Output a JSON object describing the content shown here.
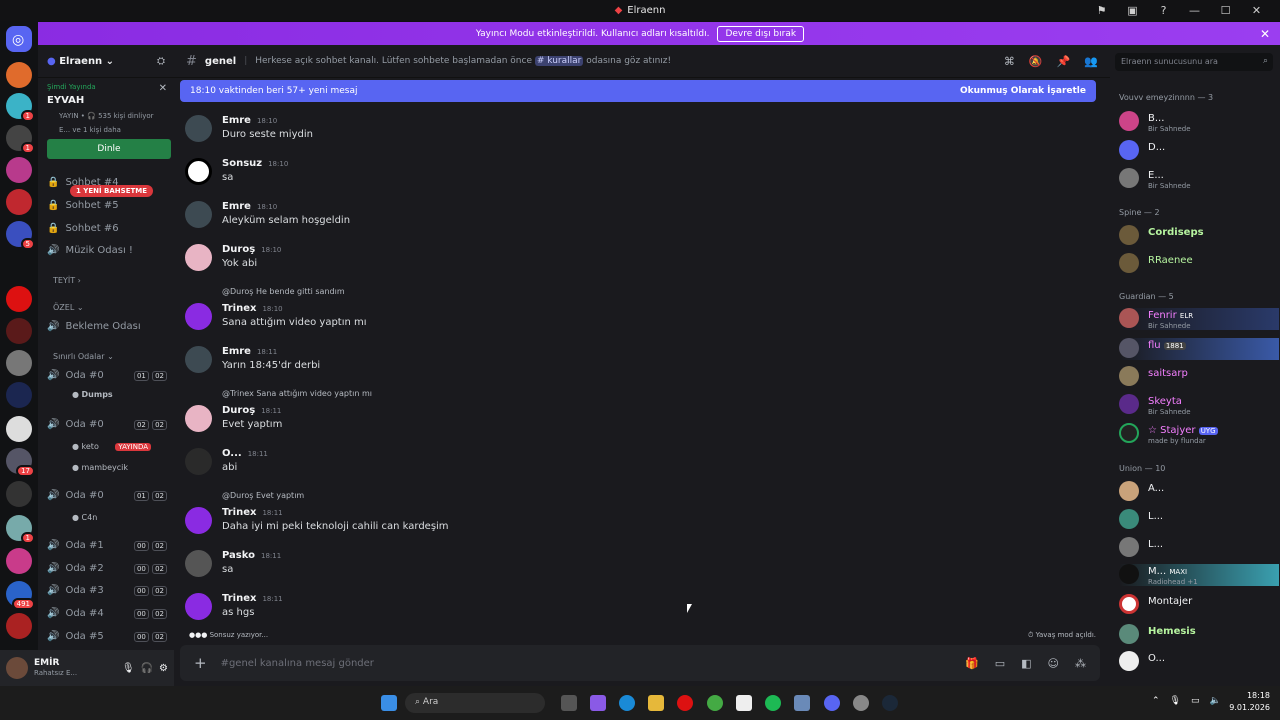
{
  "window": {
    "title": "Elraenn"
  },
  "banner": {
    "text": "Yayıncı Modu etkinleştirildi. Kullanıcı adları kısaltıldı.",
    "button": "Devre dışı bırak"
  },
  "server": {
    "name": "Elraenn"
  },
  "live_card": {
    "status": "Şimdi Yayında",
    "title": "EYVAH",
    "meta": "YAYIN • 🎧 535 kişi dinliyor",
    "listeners": "E... ve 1 kişi daha",
    "button": "Dinle"
  },
  "channels": {
    "mention_badge": "1 YENİ BAHSETME",
    "items": [
      "Sohbet #4",
      "Sohbet #5",
      "Sohbet #6",
      "Müzik Odası !"
    ],
    "cat_teyit": "TEYİT",
    "cat_ozel": "ÖZEL",
    "waiting": "Bekleme Odası",
    "cat_limited": "Sınırlı Odalar",
    "voice": [
      {
        "name": "Oda #0",
        "a": "01",
        "b": "02",
        "users": [
          {
            "name": "Dumps"
          }
        ]
      },
      {
        "name": "Oda #0",
        "a": "02",
        "b": "02",
        "users": [
          {
            "name": "keto",
            "live": "YAYINDA"
          },
          {
            "name": "mambeycik"
          }
        ]
      },
      {
        "name": "Oda #0",
        "a": "01",
        "b": "02",
        "users": [
          {
            "name": "C4n"
          }
        ]
      },
      {
        "name": "Oda #1",
        "a": "00",
        "b": "02"
      },
      {
        "name": "Oda #2",
        "a": "00",
        "b": "02"
      },
      {
        "name": "Oda #3",
        "a": "00",
        "b": "02"
      },
      {
        "name": "Oda #4",
        "a": "00",
        "b": "02"
      },
      {
        "name": "Oda #5",
        "a": "00",
        "b": "02"
      }
    ]
  },
  "user_panel": {
    "name": "EMİR",
    "status": "Rahatsız E..."
  },
  "channel_header": {
    "name": "genel",
    "topic_a": "Herkese açık sohbet kanalı. Lütfen sohbete başlamadan önce",
    "topic_link": "# kurallar",
    "topic_b": "odasına göz atınız!"
  },
  "new_bar": {
    "left": "18:10 vaktinden beri 57+ yeni mesaj",
    "right": "Okunmuş Olarak İşaretle"
  },
  "messages": [
    {
      "author": "Emre",
      "time": "18:10",
      "text": "Duro seste miydin"
    },
    {
      "author": "Sonsuz",
      "time": "18:10",
      "text": "sa"
    },
    {
      "author": "Emre",
      "time": "18:10",
      "text": "Aleyküm selam hoşgeldin"
    },
    {
      "author": "Duroş",
      "time": "18:10",
      "text": "Yok abi"
    },
    {
      "author": "Trinex",
      "time": "18:10",
      "text": "Sana attığım video yaptın mı",
      "reply": "@Duroş He bende gitti sandım"
    },
    {
      "author": "Emre",
      "time": "18:11",
      "text": "Yarın 18:45'dr derbi"
    },
    {
      "author": "Duroş",
      "time": "18:11",
      "text": "Evet yaptım",
      "reply": "@Trinex Sana attığım video yaptın mı"
    },
    {
      "author": "O...",
      "time": "18:11",
      "text": "abi"
    },
    {
      "author": "Trinex",
      "time": "18:11",
      "text": "Daha iyi mi peki teknoloji cahili can kardeşim",
      "reply": "@Duroş Evet yaptım"
    },
    {
      "author": "Pasko",
      "time": "18:11",
      "text": "sa"
    },
    {
      "author": "Trinex",
      "time": "18:11",
      "text": "as hgs"
    }
  ],
  "typing": "Sonsuz yazıyor...",
  "slowmode": "Yavaş mod açıldı.",
  "composer": {
    "placeholder": "#genel kanalına mesaj gönder"
  },
  "members": {
    "search": "Elraenn sunucusunu ara",
    "sections": [
      {
        "title": "Vouvv emeyzinnnn — 3",
        "items": [
          {
            "name": "B...",
            "sub": "Bir Sahnede"
          },
          {
            "name": "D..."
          },
          {
            "name": "E...",
            "sub": "Bir Sahnede"
          }
        ]
      },
      {
        "title": "Spine — 2",
        "items": [
          {
            "name": "Cordiseps"
          },
          {
            "name": "RRaenee"
          }
        ]
      },
      {
        "title": "Guardian — 5",
        "items": [
          {
            "name": "Fenrir",
            "tag": "ELR",
            "sub": "Bir Sahnede"
          },
          {
            "name": "flu",
            "tag": "1881"
          },
          {
            "name": "saitsarp"
          },
          {
            "name": "Skeyta",
            "sub": "Bir Sahnede"
          },
          {
            "name": "☆ Stajyer",
            "tag": "UYG",
            "sub": "made by flundar"
          }
        ]
      },
      {
        "title": "Union — 10",
        "items": [
          {
            "name": "A..."
          },
          {
            "name": "L..."
          },
          {
            "name": "L..."
          },
          {
            "name": "M...",
            "tag": "MAXI",
            "sub": "Radiohead +1"
          },
          {
            "name": "Montajer"
          },
          {
            "name": "Hemesis"
          },
          {
            "name": "O..."
          }
        ]
      }
    ]
  },
  "taskbar": {
    "search": "Ara",
    "time": "18:18",
    "date": "9.01.2026"
  },
  "colors": {
    "accent": "#5865f2",
    "banner": "#9b3ef0",
    "mention": "#ed4245",
    "online": "#23a55a"
  }
}
